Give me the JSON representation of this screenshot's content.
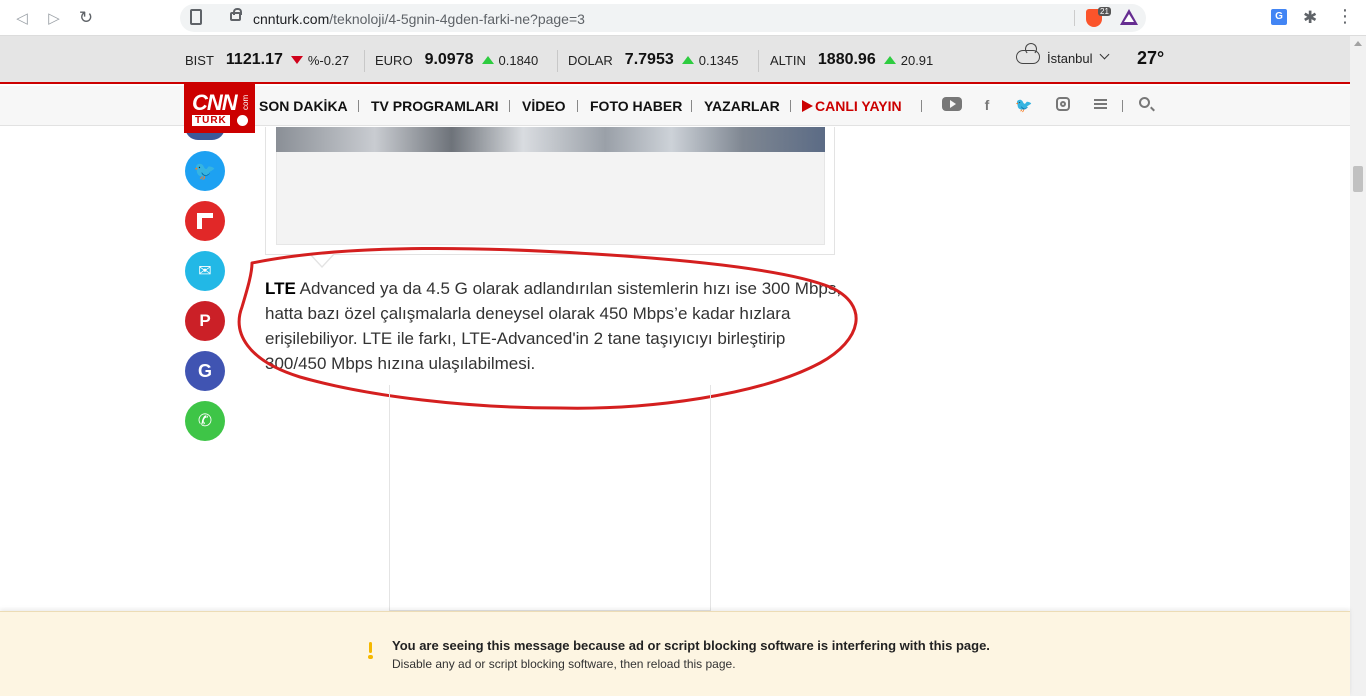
{
  "browser": {
    "url_host": "cnnturk.com",
    "url_path": "/teknoloji/4-5gnin-4gden-farki-ne?page=3",
    "brave_badge": "21",
    "translate_label": "G"
  },
  "ticker": {
    "bist": {
      "label": "BIST",
      "value": "1121.17",
      "change": "%-0.27",
      "direction": "down"
    },
    "euro": {
      "label": "EURO",
      "value": "9.0978",
      "change": "0.1840",
      "direction": "up"
    },
    "dolar": {
      "label": "DOLAR",
      "value": "7.7953",
      "change": "0.1345",
      "direction": "up"
    },
    "altin": {
      "label": "ALTIN",
      "value": "1880.96",
      "change": "20.91",
      "direction": "up"
    },
    "weather": {
      "city": "İstanbul",
      "temperature": "27°"
    }
  },
  "logo": {
    "main": "CNN",
    "sub": "TÜRK",
    "com": "com"
  },
  "nav": {
    "items": [
      "SON DAKİKA",
      "TV PROGRAMLARI",
      "VİDEO",
      "FOTO HABER",
      "YAZARLAR",
      "CANLI YAYIN"
    ]
  },
  "social_icons": [
    "youtube-icon",
    "facebook-icon",
    "twitter-icon",
    "instagram-icon",
    "menu-icon",
    "search-icon"
  ],
  "share_buttons": [
    {
      "name": "share-twitter",
      "color": "#1da1f2",
      "glyph": "🐦"
    },
    {
      "name": "share-flipboard",
      "color": "#e12828",
      "glyph": "f"
    },
    {
      "name": "share-email",
      "color": "#22b8e6",
      "glyph": "✉"
    },
    {
      "name": "share-pinterest",
      "color": "#cb2027",
      "glyph": "P"
    },
    {
      "name": "share-google",
      "color": "#4054b2",
      "glyph": "G"
    },
    {
      "name": "share-whatsapp",
      "color": "#3ec547",
      "glyph": "✆"
    }
  ],
  "article": {
    "lead": "LTE",
    "text": " Advanced ya da 4.5 G olarak adlandırılan sistemlerin hızı ise 300 Mbps, hatta bazı özel çalışmalarla deneysel olarak 450 Mbps’e kadar hızlara erişilebiliyor. LTE ile farkı, LTE-Advanced'in 2 tane taşıyıcıyı birleştirip 300/450 Mbps hızına ulaşılabilmesi."
  },
  "notice": {
    "line1": "You are seeing this message because ad or script blocking software is interfering with this page.",
    "line2": "Disable any ad or script blocking software, then reload this page."
  },
  "colors": {
    "brand_red": "#cc0000",
    "annotation_red": "#d41f1f",
    "notice_bg": "#fdf5e2"
  }
}
